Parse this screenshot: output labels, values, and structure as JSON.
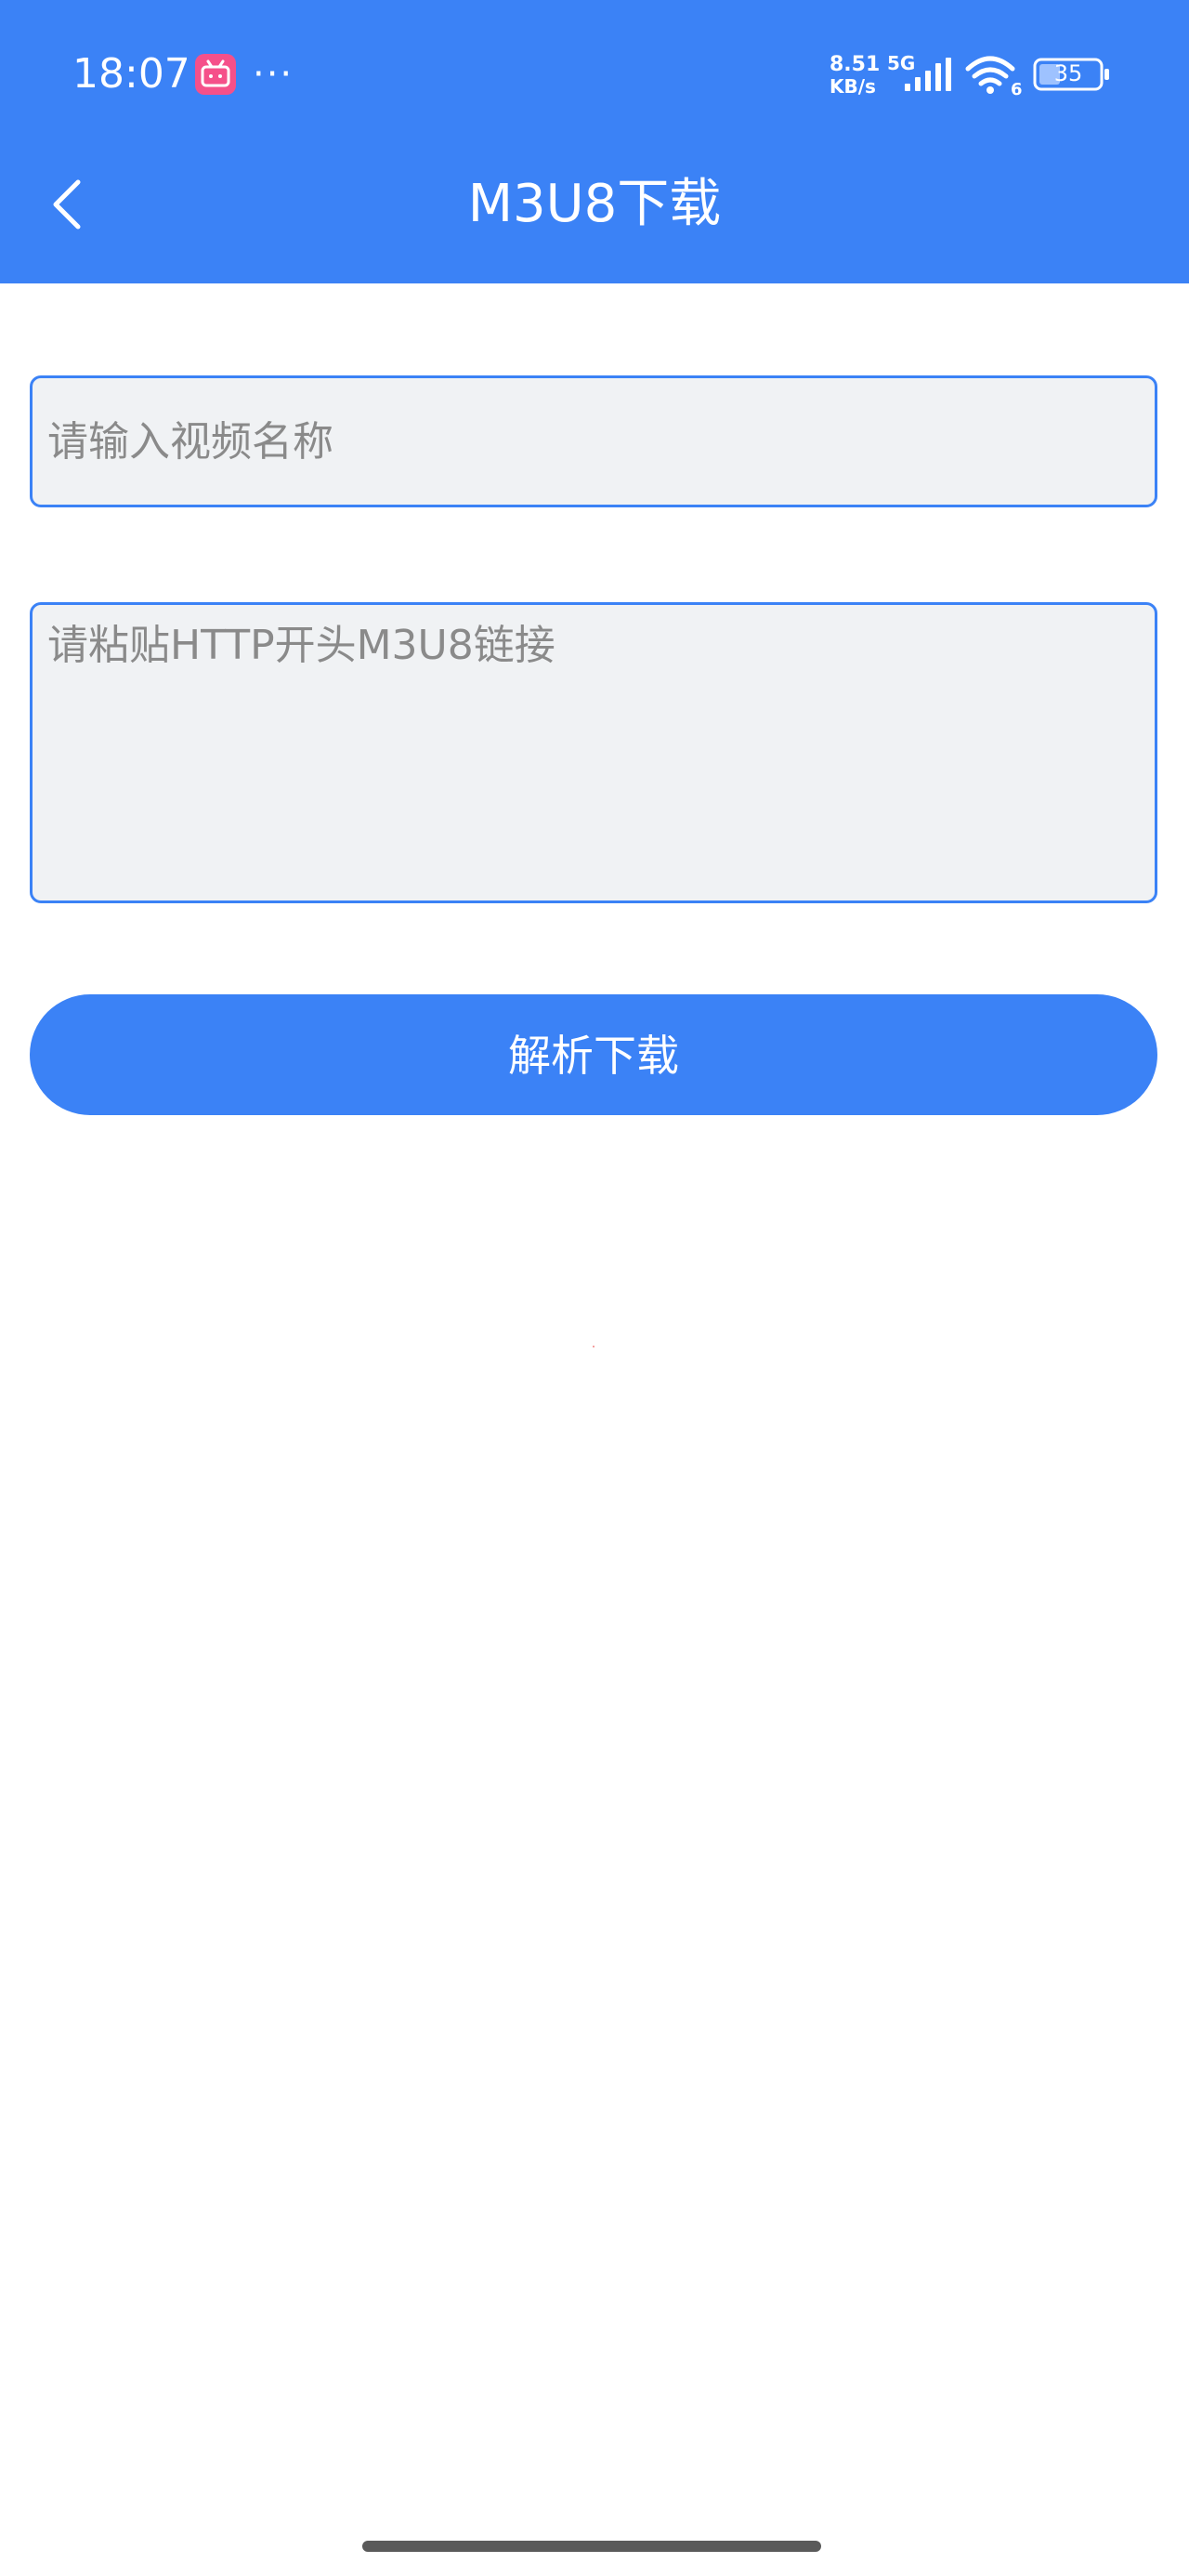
{
  "status_bar": {
    "time": "18:07",
    "more_indicator": "···",
    "net_speed_value": "8.51",
    "net_speed_unit": "KB/s",
    "network_gen": "5G",
    "wifi_sub": "6",
    "battery_level": "35",
    "icons": [
      "bilibili-app-icon",
      "signal-icon",
      "wifi-icon",
      "battery-icon"
    ]
  },
  "header": {
    "back_icon": "chevron-left-icon",
    "title": "M3U8下载",
    "background_color": "#3b82f6"
  },
  "form": {
    "name_placeholder": "请输入视频名称",
    "name_value": "",
    "url_placeholder": "请粘贴HTTP开头M3U8链接",
    "url_value": "",
    "submit_label": "解析下载"
  },
  "colors": {
    "accent": "#3b82f6",
    "input_background": "#f0f2f4",
    "placeholder_text": "#8a8a8a"
  }
}
